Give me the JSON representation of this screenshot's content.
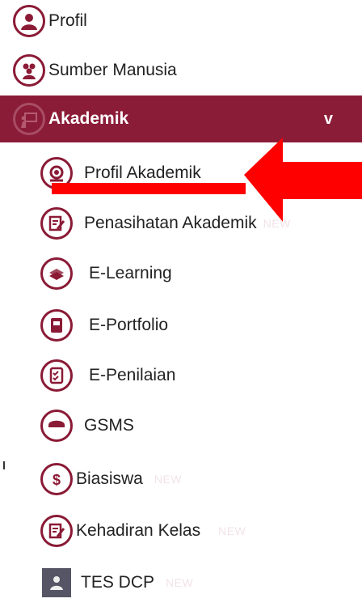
{
  "menu": {
    "profil": "Profil",
    "sumber_manusia": "Sumber Manusia",
    "akademik": "Akademik",
    "akademik_chevron": "v",
    "profil_akademik": "Profil Akademik",
    "penasihatan_akademik": "Penasihatan Akademik",
    "e_learning": "E-Learning",
    "e_portfolio": "E-Portfolio",
    "e_penilaian": "E-Penilaian",
    "gsms": "GSMS",
    "biasiswa": "Biasiswa",
    "kehadiran_kelas": "Kehadiran Kelas",
    "tes_dcp": "TES DCP",
    "new_badge": "NEW"
  },
  "colors": {
    "brand": "#8b1c37",
    "arrow": "#ff0000"
  }
}
